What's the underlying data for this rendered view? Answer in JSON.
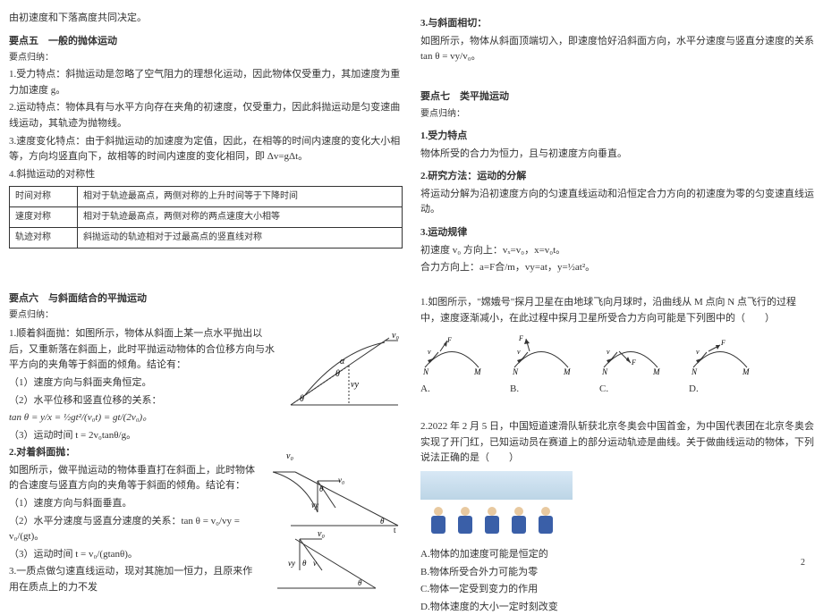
{
  "col1": {
    "intro": "由初速度和下落高度共同决定。",
    "s5_title": "要点五　一般的抛体运动",
    "s5_sub": "要点归纳：",
    "s5_p1": "1.受力特点：斜抛运动是忽略了空气阻力的理想化运动，因此物体仅受重力，其加速度为重力加速度 g。",
    "s5_p2": "2.运动特点：物体具有与水平方向存在夹角的初速度，仅受重力，因此斜抛运动是匀变速曲线运动，其轨迹为抛物线。",
    "s5_p3": "3.速度变化特点：由于斜抛运动的加速度为定值，因此，在相等的时间内速度的变化大小相等，方向均竖直向下，故相等的时间内速度的变化相同，即 Δv=gΔt。",
    "s5_p4": "4.斜抛运动的对称性",
    "tbl": [
      [
        "时间对称",
        "相对于轨迹最高点，两侧对称的上升时间等于下降时间"
      ],
      [
        "速度对称",
        "相对于轨迹最高点，两侧对称的两点速度大小相等"
      ],
      [
        "轨迹对称",
        "斜抛运动的轨迹相对于过最高点的竖直线对称"
      ]
    ],
    "s6_title": "要点六　与斜面结合的平抛运动",
    "s6_sub": "要点归纳：",
    "s6_1_title": "1.顺着斜面抛：如图所示，物体从斜面上某一点水平抛出以后，又重新落在斜面上，此时平抛运动物体的合位移方向与水平方向的夹角等于斜面的倾角。结论有：",
    "s6_1_a": "（1）速度方向与斜面夹角恒定。",
    "s6_1_b": "（2）水平位移和竖直位移的关系：",
    "s6_1_f1": "tan θ = y/x = ½gt²/(v₀t) = gt/(2v₀)。",
    "s6_1_c": "（3）运动时间 t = 2v₀tanθ/g。",
    "s6_2_title": "2.对着斜面抛：",
    "s6_2_desc": "如图所示，做平抛运动的物体垂直打在斜面上，此时物体的合速度与竖直方向的夹角等于斜面的倾角。结论有：",
    "s6_2_a": "（1）速度方向与斜面垂直。",
    "s6_2_b": "（2）水平分速度与竖直分速度的关系：tan θ = v₀/vy = v₀/(gt)。",
    "s6_2_c": "（3）运动时间 t = v₀/(gtanθ)。",
    "s6_3": "3.一质点做匀速直线运动，现对其施加一恒力，且原来作用在质点上的力不发"
  },
  "col2": {
    "s6_3b_title": "3.与斜面相切：",
    "s6_3b_desc": "如图所示，物体从斜面顶端切入，即速度恰好沿斜面方向，水平分速度与竖直分速度的关系 tan θ = vy/v₀。",
    "s7_title": "要点七　类平抛运动",
    "s7_sub": "要点归纳：",
    "s7_1t": "1.受力特点",
    "s7_1d": "物体所受的合力为恒力，且与初速度方向垂直。",
    "s7_2t": "2.研究方法：运动的分解",
    "s7_2d": "将运动分解为沿初速度方向的匀速直线运动和沿恒定合力方向的初速度为零的匀变速直线运动。",
    "s7_3t": "3.运动规律",
    "s7_3a": "初速度 v₀ 方向上：vₓ=v₀，x=v₀t。",
    "s7_3b": "合力方向上：a=F合/m，vy=at，y=½at²。",
    "q1": "1.如图所示，\"嫦娥号\"探月卫星在由地球飞向月球时，沿曲线从 M 点向 N 点飞行的过程中，速度逐渐减小，在此过程中探月卫星所受合力方向可能是下列图中的（　　）",
    "q1_opts": [
      "A.",
      "B.",
      "C.",
      "D."
    ],
    "q2": "2.2022 年 2 月 5 日，中国短道速滑队斩获北京冬奥会中国首金，为中国代表团在北京冬奥会实现了开门红，已知运动员在赛道上的部分运动轨迹是曲线。关于做曲线运动的物体，下列说法正确的是（　　）",
    "q2_a": "A.物体的加速度可能是恒定的",
    "q2_b": "B.物体所受合外力可能为零",
    "q2_c": "C.物体一定受到变力的作用",
    "q2_d": "D.物体速度的大小一定时刻改变",
    "page": "2"
  }
}
